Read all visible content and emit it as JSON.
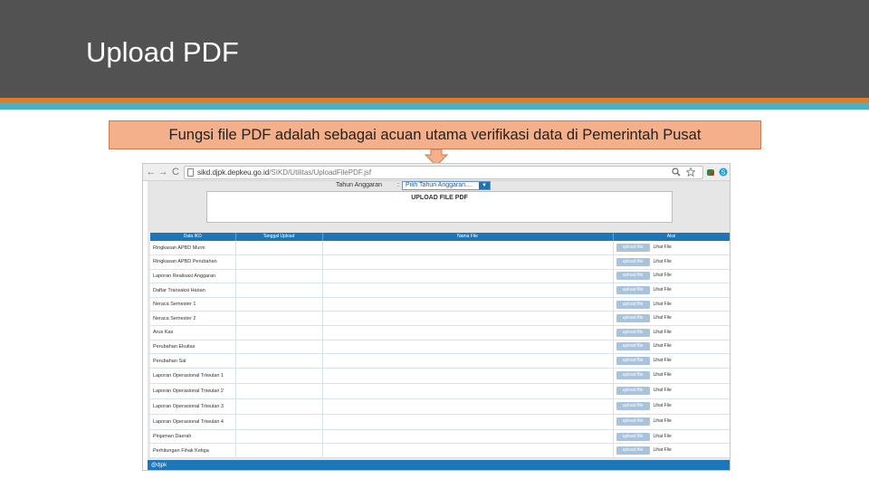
{
  "slide": {
    "title": "Upload PDF",
    "callout": "Fungsi file PDF adalah sebagai acuan utama verifikasi data di Pemerintah Pusat"
  },
  "browser": {
    "url_host": "sikd.djpk.depkeu.go.id",
    "url_path": "/SIKD/Utilitas/UploadFilePDF.jsf",
    "back_glyph": "←",
    "forward_glyph": "→",
    "reload_glyph": "C"
  },
  "page": {
    "tahun_label": "Tahun Anggaran",
    "tahun_colon": ":",
    "tahun_select": "Pilih Tahun Anggaran....",
    "dropdown_glyph": "▼",
    "panel_title": "UPLOAD FILE PDF",
    "footer": "@djpk"
  },
  "table": {
    "headers": [
      "Data IKD",
      "Tanggal Upload",
      "Nama File",
      "Aksi"
    ],
    "upload_label": "upload file",
    "view_label": "Lihat File",
    "rows": [
      {
        "name": "Ringkasan APBD Murni",
        "tall": false
      },
      {
        "name": "Ringkasan APBD Perubahan",
        "tall": false
      },
      {
        "name": "Laporan Realisasi Anggaran",
        "tall": false
      },
      {
        "name": "Daftar Transaksi Harian",
        "tall": false
      },
      {
        "name": "Neraca Semester 1",
        "tall": false
      },
      {
        "name": "Neraca Semester 2",
        "tall": false
      },
      {
        "name": "Arus Kas",
        "tall": false
      },
      {
        "name": "Perubahan Ekuitas",
        "tall": false
      },
      {
        "name": "Perubahan Sal",
        "tall": false
      },
      {
        "name": "Laporan Operasional Triwulan 1",
        "tall": true
      },
      {
        "name": "Laporan Operasional Triwulan 2",
        "tall": true
      },
      {
        "name": "Laporan Operasional Triwulan 3",
        "tall": true
      },
      {
        "name": "Laporan Operasional Triwulan 4",
        "tall": true
      },
      {
        "name": "Pinjaman Daerah",
        "tall": false
      },
      {
        "name": "Perhitungan Fihak Ketiga",
        "tall": false
      }
    ]
  },
  "colors": {
    "header_bg": "#525252",
    "stripe_orange": "#e07b2a",
    "stripe_teal": "#4bb2c4",
    "callout_bg": "#f3b08a",
    "table_header": "#1d76b7"
  },
  "icons": [
    "document-icon",
    "zoom-icon",
    "star-icon",
    "extension-icon",
    "skype-icon",
    "arrow-down-icon"
  ]
}
